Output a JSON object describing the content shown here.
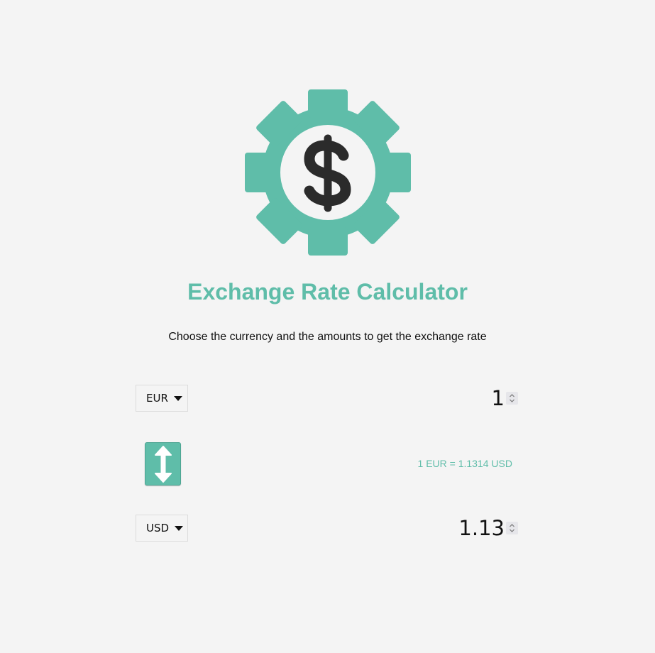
{
  "header": {
    "logo_icon": "gear-dollar-icon",
    "title": "Exchange Rate Calculator",
    "subtitle": "Choose the currency and the amounts to get the exchange rate"
  },
  "currency_one": {
    "selected": "EUR",
    "amount": "1"
  },
  "currency_two": {
    "selected": "USD",
    "amount": "1.13"
  },
  "swap_button": {
    "icon": "swap-vertical-arrow-icon"
  },
  "rate_text": "1 EUR = 1.1314 USD",
  "colors": {
    "accent": "#5fbda9",
    "background": "#f4f4f4",
    "icon_dark": "#2b2b2b"
  }
}
